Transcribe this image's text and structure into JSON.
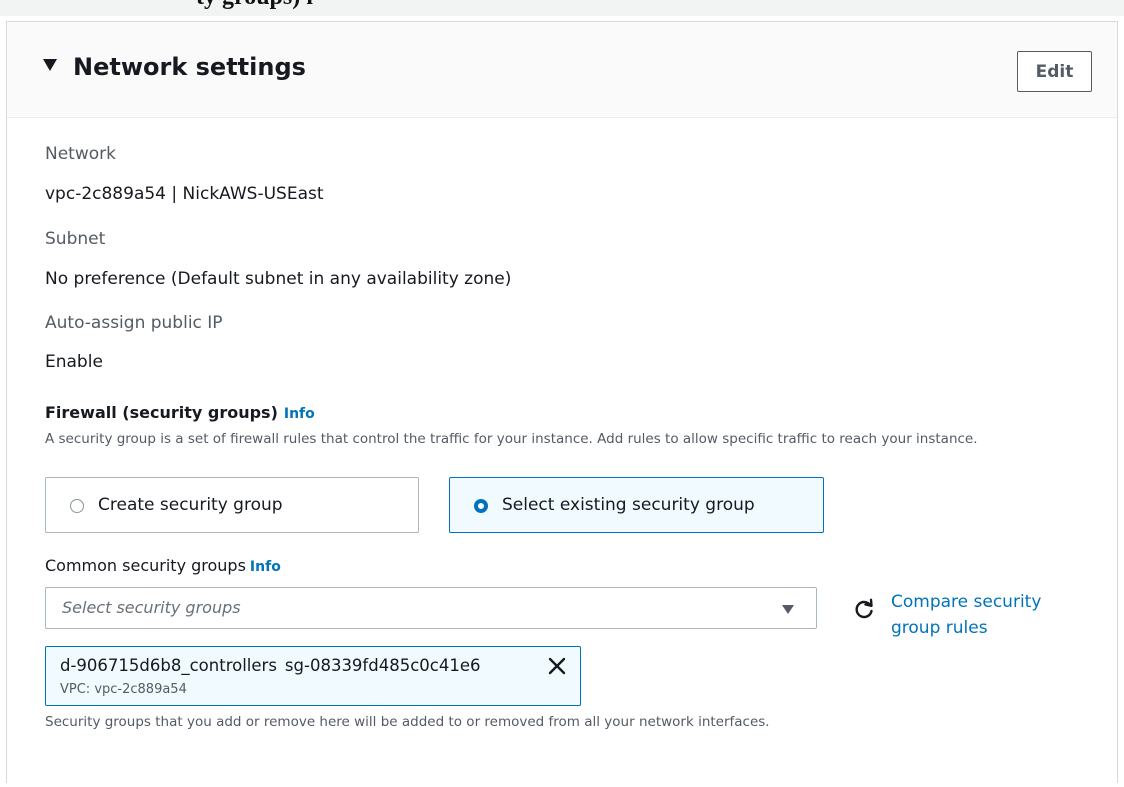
{
  "header_strip": {
    "text": "ty groups) i"
  },
  "panel": {
    "title": "Network settings",
    "edit_label": "Edit"
  },
  "fields": {
    "network_label": "Network",
    "network_value": "vpc-2c889a54 | NickAWS-USEast",
    "subnet_label": "Subnet",
    "subnet_value": "No preference (Default subnet in any availability zone)",
    "public_ip_label": "Auto-assign public IP",
    "public_ip_value": "Enable"
  },
  "firewall": {
    "heading": "Firewall (security groups)",
    "info": "Info",
    "description": "A security group is a set of firewall rules that control the traffic for your instance. Add rules to allow specific traffic to reach your instance.",
    "options": [
      {
        "label": "Create security group",
        "selected": false
      },
      {
        "label": "Select existing security group",
        "selected": true
      }
    ]
  },
  "common_groups": {
    "heading": "Common security groups",
    "info": "Info",
    "placeholder": "Select security groups",
    "compare_link": "Compare security group rules",
    "token": {
      "name": "d-906715d6b8_controllers",
      "id": "sg-08339fd485c0c41e6",
      "vpc": "VPC: vpc-2c889a54"
    },
    "footnote": "Security groups that you add or remove here will be added to or removed from all your network interfaces."
  },
  "colors": {
    "link": "#0073bb",
    "selected_bg": "#f1faff",
    "text": "#16191f",
    "muted": "#545b64"
  },
  "icons": {
    "collapse": "caret-down-icon",
    "dropdown": "dropdown-caret-icon",
    "refresh": "refresh-icon",
    "remove": "close-icon"
  }
}
